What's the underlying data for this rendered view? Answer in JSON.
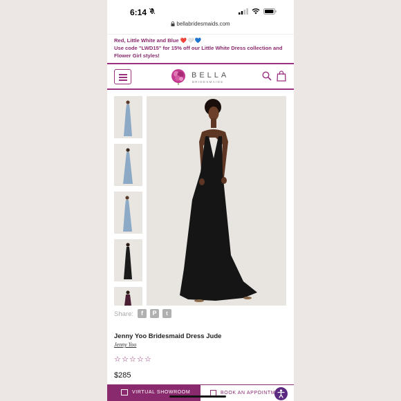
{
  "status_bar": {
    "time": "6:14"
  },
  "browser": {
    "url": "bellabridesmaids.com"
  },
  "promo": {
    "line1": "Red, Little White and Blue",
    "hearts": "❤️🤍💙",
    "line2": "Use code \"LWD15\" for 15% off our Little White Dress collection and Flower Girl styles!"
  },
  "header": {
    "logo_word": "BELLA",
    "logo_sub": "BRIDESMAIDS"
  },
  "gallery": {
    "thumbnails": [
      {
        "dress_color": "#8ca9c6"
      },
      {
        "dress_color": "#8ca9c6"
      },
      {
        "dress_color": "#8ca9c6"
      },
      {
        "dress_color": "#1b1b1b"
      },
      {
        "dress_color": "#4a1f33"
      }
    ],
    "main_dress_color": "#151515"
  },
  "share": {
    "label": "Share:",
    "icons": [
      "facebook-icon",
      "pinterest-icon",
      "twitter-icon"
    ]
  },
  "product": {
    "title": "Jenny Yoo Bridesmaid Dress Jude",
    "brand": "Jenny Yoo",
    "rating_stars": 0,
    "rating_max": 5,
    "price": "$285"
  },
  "actions": {
    "virtual_showroom": "VIRTUAL SHOWROOM",
    "book_appointment": "BOOK AN APPOINTMENT"
  },
  "colors": {
    "accent": "#8a2a6e",
    "header_rule": "#9b2f7f"
  }
}
